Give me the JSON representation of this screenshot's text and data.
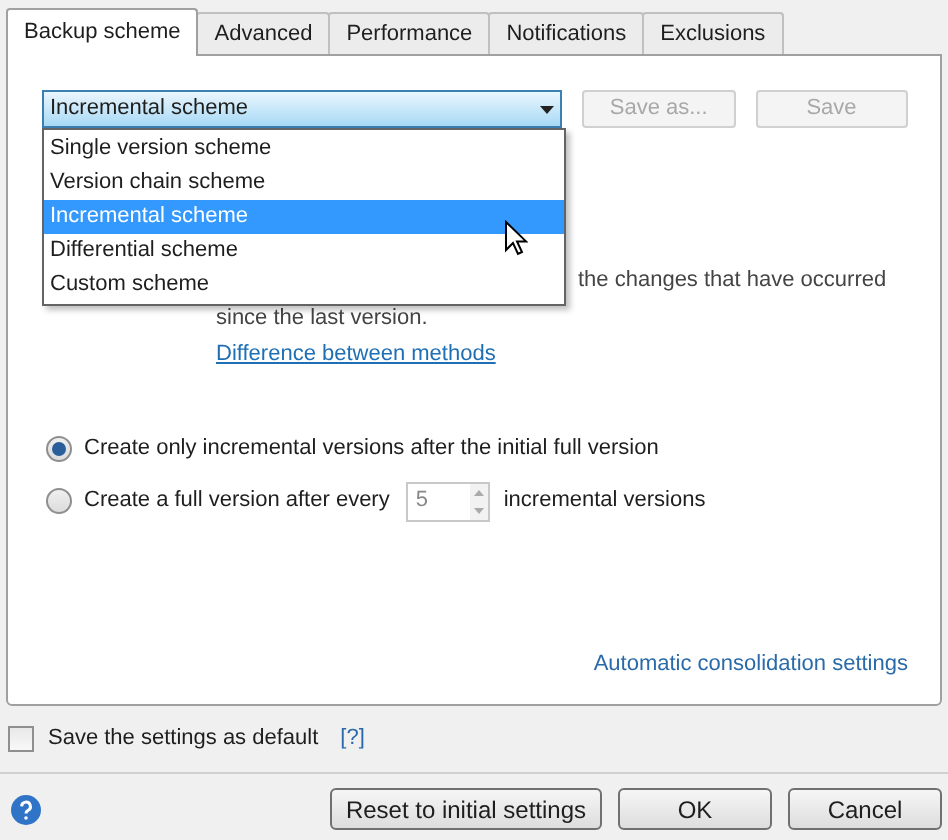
{
  "tabs": [
    {
      "label": "Backup scheme",
      "selected": true
    },
    {
      "label": "Advanced",
      "selected": false
    },
    {
      "label": "Performance",
      "selected": false
    },
    {
      "label": "Notifications",
      "selected": false
    },
    {
      "label": "Exclusions",
      "selected": false
    }
  ],
  "scheme_select": {
    "value": "Incremental scheme",
    "expanded": true,
    "options": [
      {
        "label": "Single version scheme",
        "selected": false
      },
      {
        "label": "Version chain scheme",
        "selected": false
      },
      {
        "label": "Incremental scheme",
        "selected": true
      },
      {
        "label": "Differential scheme",
        "selected": false
      },
      {
        "label": "Custom scheme",
        "selected": false
      }
    ]
  },
  "scheme_buttons": [
    {
      "label": "Save as...",
      "disabled": true
    },
    {
      "label": "Save",
      "disabled": true
    }
  ],
  "description": [
    "the changes that have occurred",
    "since the last version."
  ],
  "difference_link": "Difference between methods",
  "options": [
    {
      "label": "Create only incremental versions after the initial full version",
      "selected": true
    },
    {
      "label": "Create a full version after every",
      "selected": false,
      "count": "5",
      "suffix": "incremental versions"
    }
  ],
  "consolidation_link": "Automatic consolidation settings",
  "save_default": {
    "label": "Save the settings as default",
    "checked": false,
    "help": "[?]"
  },
  "footer_buttons": [
    "Reset to initial settings",
    "OK",
    "Cancel"
  ]
}
